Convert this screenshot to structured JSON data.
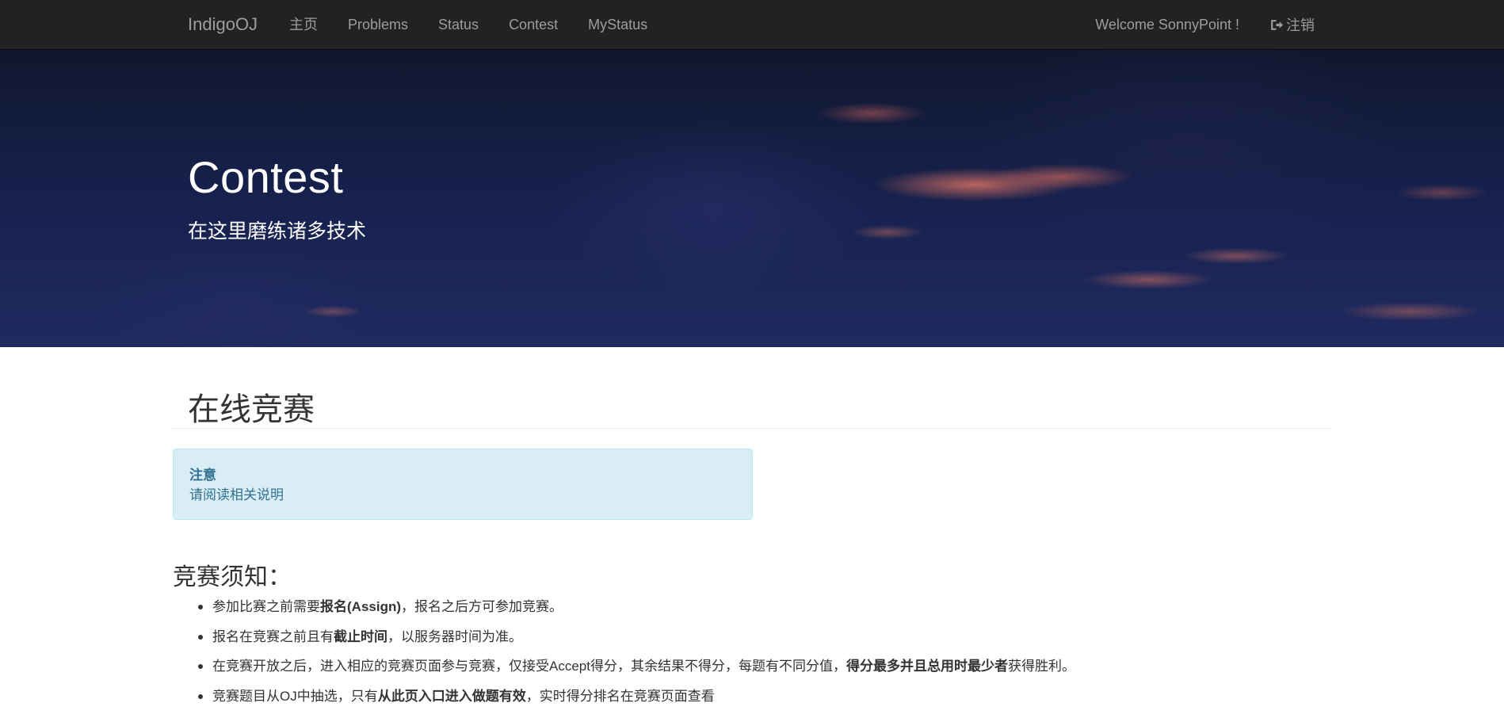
{
  "navbar": {
    "brand": "IndigoOJ",
    "links": [
      "主页",
      "Problems",
      "Status",
      "Contest",
      "MyStatus"
    ],
    "welcome": "Welcome SonnyPoint !",
    "logout_label": "注销",
    "logout_icon": "sign-out-icon",
    "bg_color": "#222222"
  },
  "hero": {
    "title": "Contest",
    "subtitle": "在这里磨练诸多技术"
  },
  "main": {
    "page_title": "在线竞赛",
    "alert": {
      "title": "注意",
      "text": "请阅读相关说明",
      "bg_color": "#d9edf7",
      "text_color": "#31708f"
    },
    "rules_title": "竞赛须知：",
    "rules": [
      {
        "a": "参加比赛之前需要",
        "b": "报名(Assign)",
        "c": "，报名之后方可参加竞赛。",
        "d": "",
        "e": ""
      },
      {
        "a": "报名在竞赛之前且有",
        "b": "截止时间",
        "c": "，以服务器时间为准。",
        "d": "",
        "e": ""
      },
      {
        "a": "在竞赛开放之后，进入相应的竞赛页面参与竞赛，仅接受Accept得分，其余结果不得分，每题有不同分值，",
        "b": "得分最多并且总用时最少者",
        "c": "获得胜利。",
        "d": "",
        "e": ""
      },
      {
        "a": "竞赛题目从OJ中抽选，只有",
        "b": "从此页入口进入做题有效",
        "c": "，实时得分排名在竞赛页面查看",
        "d": "",
        "e": ""
      }
    ]
  }
}
